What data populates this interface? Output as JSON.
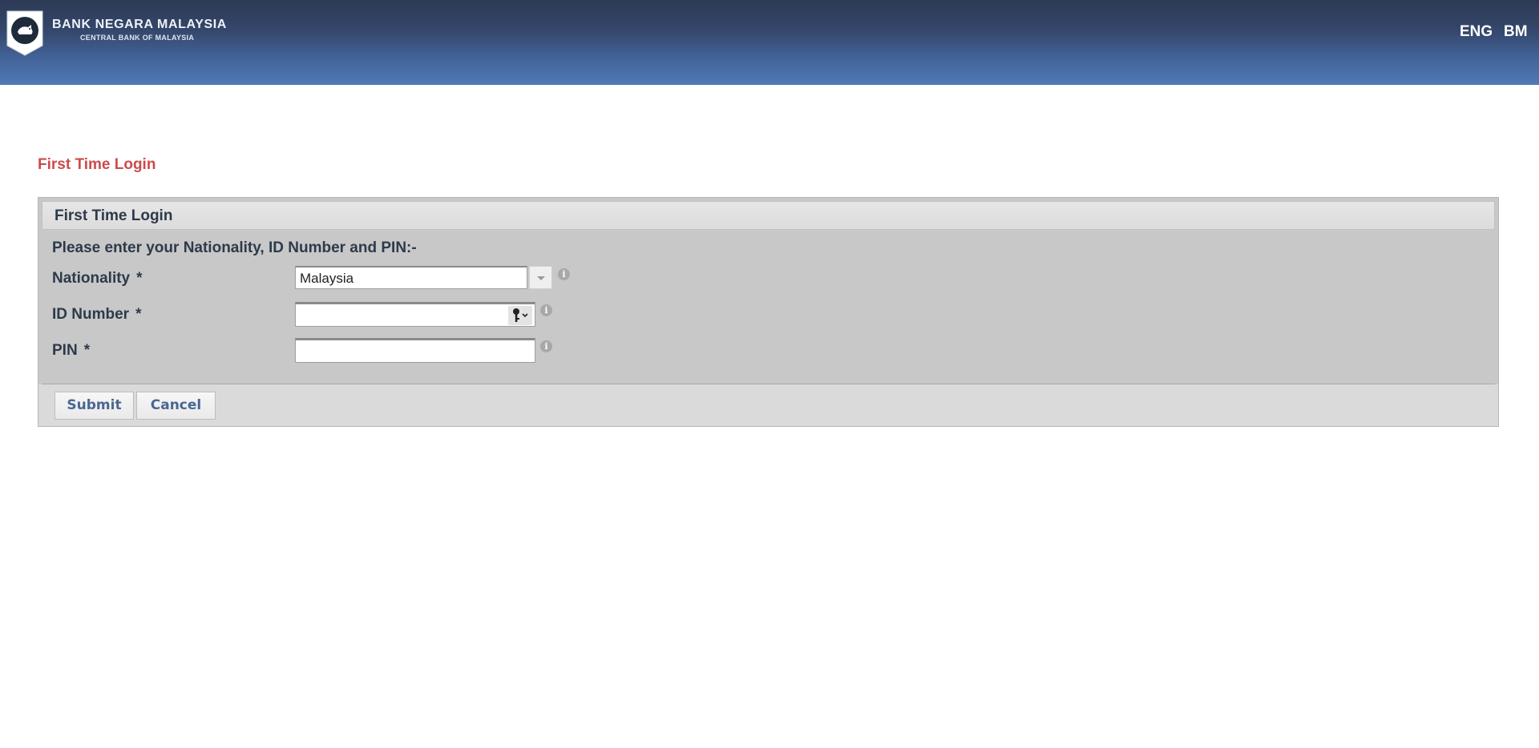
{
  "header": {
    "bank_name": "BANK NEGARA MALAYSIA",
    "bank_subtitle": "CENTRAL BANK OF MALAYSIA",
    "languages": [
      "ENG",
      "BM"
    ]
  },
  "page": {
    "title": "First Time Login"
  },
  "panel": {
    "heading": "First Time Login",
    "instructions": "Please enter your Nationality, ID Number and PIN:-",
    "fields": {
      "nationality": {
        "label": "Nationality",
        "required_mark": "*",
        "value": "Malaysia"
      },
      "id_number": {
        "label": "ID Number",
        "required_mark": "*",
        "value": ""
      },
      "pin": {
        "label": "PIN",
        "required_mark": "*",
        "value": ""
      }
    },
    "buttons": {
      "submit": "Submit",
      "cancel": "Cancel"
    }
  },
  "icons": {
    "info": "info-icon",
    "key": "key-icon",
    "dropdown": "chevron-down-icon"
  },
  "colors": {
    "header_top": "#2c3a55",
    "header_bottom": "#5079b6",
    "page_title": "#cc4b4b",
    "panel_bg": "#c8c8c8",
    "button_text": "#4a6793"
  }
}
